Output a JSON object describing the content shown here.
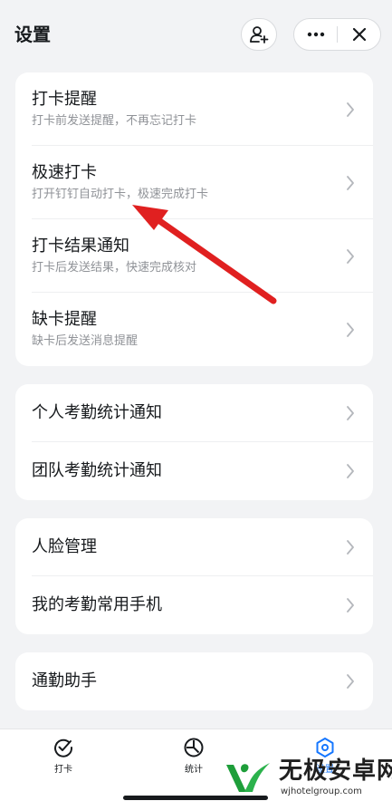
{
  "header": {
    "title": "设置"
  },
  "sections": [
    {
      "rows": [
        {
          "title": "打卡提醒",
          "subtitle": "打卡前发送提醒，不再忘记打卡"
        },
        {
          "title": "极速打卡",
          "subtitle": "打开钉钉自动打卡，极速完成打卡"
        },
        {
          "title": "打卡结果通知",
          "subtitle": "打卡后发送结果，快速完成核对"
        },
        {
          "title": "缺卡提醒",
          "subtitle": "缺卡后发送消息提醒"
        }
      ]
    },
    {
      "rows": [
        {
          "title": "个人考勤统计通知"
        },
        {
          "title": "团队考勤统计通知"
        }
      ]
    },
    {
      "rows": [
        {
          "title": "人脸管理"
        },
        {
          "title": "我的考勤常用手机"
        }
      ]
    },
    {
      "rows": [
        {
          "title": "通勤助手"
        }
      ]
    }
  ],
  "tabbar": {
    "items": [
      {
        "label": "打卡",
        "icon": "checkin-icon"
      },
      {
        "label": "统计",
        "icon": "stats-icon"
      },
      {
        "label": "设置",
        "icon": "settings-icon",
        "active": true
      }
    ]
  },
  "watermark": {
    "title": "无极安卓网",
    "url": "wjhotelgroup.com"
  },
  "colors": {
    "accent": "#1677ff",
    "annotation": "#e02020"
  }
}
